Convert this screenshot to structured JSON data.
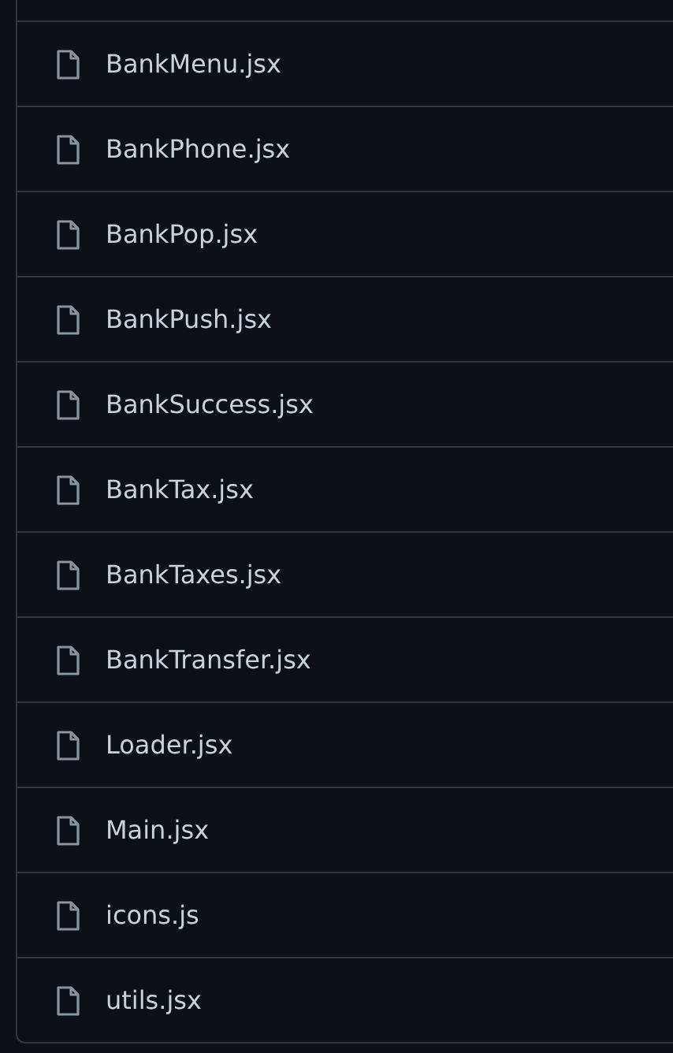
{
  "files": [
    {
      "name": "BankMenu.jsx"
    },
    {
      "name": "BankPhone.jsx"
    },
    {
      "name": "BankPop.jsx"
    },
    {
      "name": "BankPush.jsx"
    },
    {
      "name": "BankSuccess.jsx"
    },
    {
      "name": "BankTax.jsx"
    },
    {
      "name": "BankTaxes.jsx"
    },
    {
      "name": "BankTransfer.jsx"
    },
    {
      "name": "Loader.jsx"
    },
    {
      "name": "Main.jsx"
    },
    {
      "name": "icons.js"
    },
    {
      "name": "utils.jsx"
    }
  ]
}
